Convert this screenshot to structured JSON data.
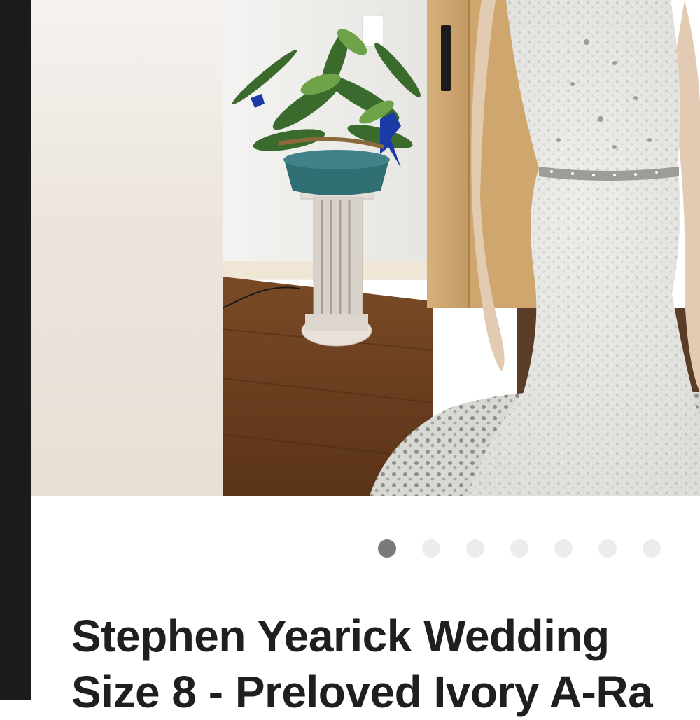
{
  "listing": {
    "title_line_1": "Stephen Yearick Wedding",
    "title_line_2": "Size 8 - Preloved Ivory A-Ra"
  },
  "gallery": {
    "image_count": 7,
    "active_index": 0
  },
  "colors": {
    "active_dot": "#7a7a7a",
    "inactive_dot": "#ececec",
    "title_text": "#1f1f1f",
    "left_bar": "#1c1c1c"
  }
}
